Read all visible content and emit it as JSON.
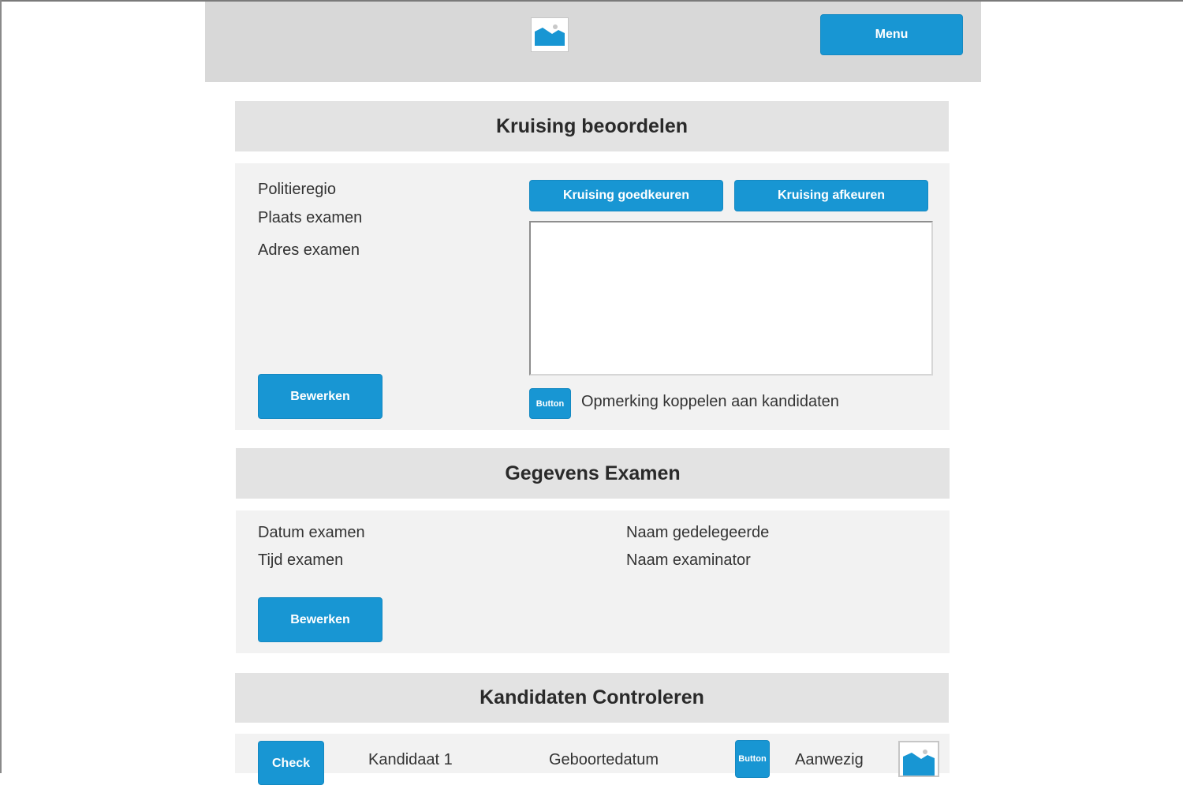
{
  "header": {
    "menu_label": "Menu",
    "logo_icon": "image-placeholder-icon"
  },
  "accent_color": "#1896d3",
  "section1": {
    "title": "Kruising beoordelen",
    "fields": [
      "Politieregio",
      "Plaats examen",
      "Adres examen"
    ],
    "approve_label": "Kruising goedkeuren",
    "reject_label": "Kruising afkeuren",
    "comment_value": "",
    "edit_label": "Bewerken",
    "small_button_label": "Button",
    "link_comment_label": "Opmerking koppelen aan kandidaten"
  },
  "section2": {
    "title": "Gegevens Examen",
    "fields_left": [
      "Datum examen",
      "Tijd examen"
    ],
    "fields_right": [
      "Naam gedelegeerde",
      "Naam examinator"
    ],
    "edit_label": "Bewerken"
  },
  "section3": {
    "title": "Kandidaten Controleren",
    "row": {
      "check_label": "Check",
      "candidate": "Kandidaat 1",
      "birthdate": "Geboortedatum",
      "button_label": "Button",
      "present": "Aanwezig",
      "photo_icon": "image-placeholder-icon"
    }
  }
}
